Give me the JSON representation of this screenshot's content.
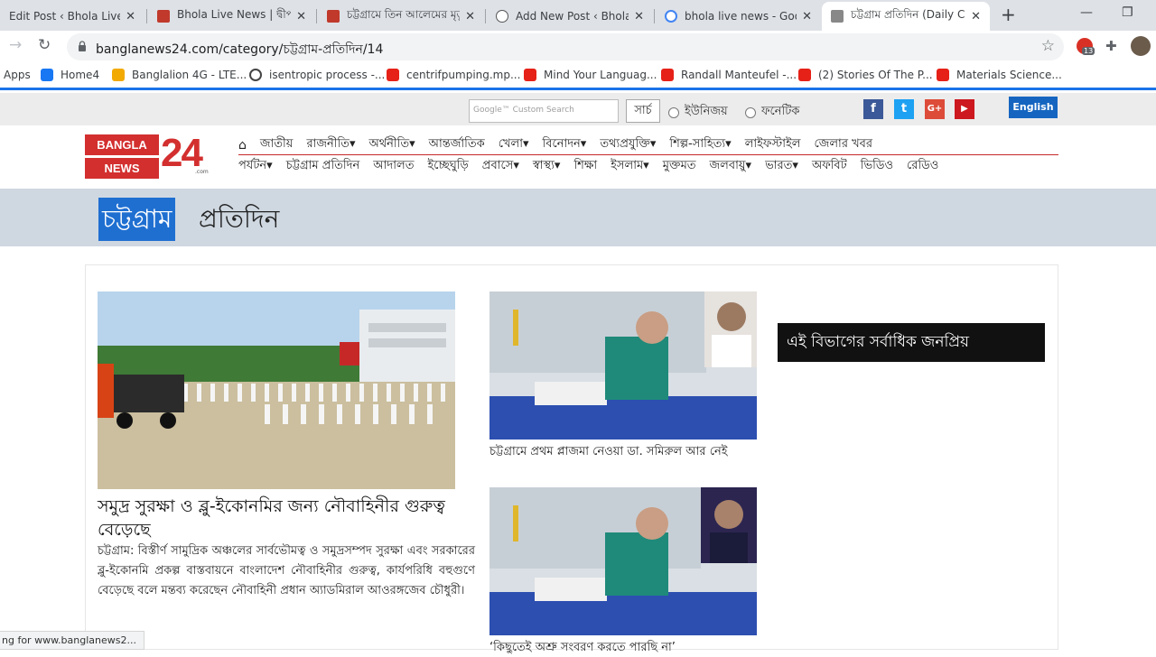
{
  "browser": {
    "tabs": [
      {
        "title": "Edit Post ‹ Bhola Live News",
        "fav_color": "#4a4a4a"
      },
      {
        "title": "Bhola Live News | দ্বীপজেলা",
        "fav_color": "#c0392b"
      },
      {
        "title": "চট্টগ্রামে তিন আলেমের মৃত্যু",
        "fav_color": "#c0392b"
      },
      {
        "title": "Add New Post ‹ Bhola Live",
        "fav_color": "#555555"
      },
      {
        "title": "bhola live news - Google",
        "fav_color": "#4285f4"
      },
      {
        "title": "চট্টগ্রাম প্রতিদিন (Daily Chattogram)",
        "fav_color": "#888888"
      }
    ],
    "tab_close": "✕",
    "new_tab": "+",
    "minimize": "—",
    "restore": "❐",
    "url": "banglanews24.com/category/চট্টগ্রাম-প্রতিদিন/14",
    "ext_badge": "13",
    "bookmarks": [
      {
        "label": "Apps",
        "color": "#4285f4"
      },
      {
        "label": "Home4",
        "color": "#1877f2"
      },
      {
        "label": "Banglalion 4G - LTE...",
        "color": "#f2a900"
      },
      {
        "label": "isentropic process -...",
        "color": "#444444"
      },
      {
        "label": "centrifpumping.mp...",
        "color": "#e62117"
      },
      {
        "label": "Mind Your Languag...",
        "color": "#e62117"
      },
      {
        "label": "Randall Manteufel -...",
        "color": "#e62117"
      },
      {
        "label": "(2) Stories Of The P...",
        "color": "#e62117"
      },
      {
        "label": "Materials Science...",
        "color": "#e62117"
      }
    ]
  },
  "site": {
    "search_placeholder": "Google™ Custom Search",
    "search_button": "সার্চ",
    "radio_unicode": "ইউনিজয়",
    "radio_phonetic": "ফনেটিক",
    "social": {
      "facebook": "f",
      "twitter": "t",
      "gplus": "G+",
      "youtube": "▶"
    },
    "english_button": "English",
    "logo": {
      "line1": "BANGLA",
      "line2": "NEWS",
      "number": "24",
      "dotcom": ".com"
    },
    "nav_row1": [
      "জাতীয়",
      "রাজনীতি▾",
      "অর্থনীতি▾",
      "আন্তর্জাতিক",
      "খেলা▾",
      "বিনোদন▾",
      "তথ্যপ্রযুক্তি▾",
      "শিল্প-সাহিত্য▾",
      "লাইফস্টাইল",
      "জেলার খবর"
    ],
    "nav_row2": [
      "পর্যটন▾",
      "চট্টগ্রাম প্রতিদিন",
      "আদালত",
      "ইচ্ছেঘুড়ি",
      "প্রবাসে▾",
      "স্বাস্থ্য▾",
      "শিক্ষা",
      "ইসলাম▾",
      "মুক্তমত",
      "জলবায়ু▾",
      "ভারত▾",
      "অফবিট",
      "ভিডিও",
      "রেডিও"
    ],
    "banner_highlight": "চট্টগ্রাম",
    "banner_rest": "প্রতিদিন",
    "lead": {
      "title": "সমুদ্র সুরক্ষা ও ব্লু-ইকোনমির জন্য নৌবাহিনীর গুরুত্ব বেড়েছে",
      "text": "চট্টগ্রাম: বিস্তীর্ণ সামুদ্রিক অঞ্চলের সার্বভৌমত্ব ও সমুদ্রসম্পদ সুরক্ষা এবং সরকারের ব্লু-ইকোনমি প্রকল্প বাস্তবায়নে বাংলাদেশ নৌবাহিনীর গুরুত্ব, কার্যপরিধি বহুগুণে বেড়েছে বলে মন্তব্য করেছেন নৌবাহিনী প্রধান অ্যাডমিরাল আওরঙ্গজেব চৌধুরী।"
    },
    "cards": [
      {
        "title": "চট্টগ্রামে প্রথম প্লাজমা নেওয়া ডা. সমিরুল আর নেই"
      },
      {
        "title": "‘কিছুতেই অশ্রু সংবরণ করতে পারছি না’"
      }
    ],
    "popular_heading": "এই বিভাগের সর্বাধিক জনপ্রিয়"
  },
  "status_text": "ng for www.banglanews2...",
  "colors": {
    "accent": "#d32f2f",
    "chrome_blue": "#1a73e8",
    "banner": "#cfd8e1",
    "highlight": "#1f6fd1"
  }
}
